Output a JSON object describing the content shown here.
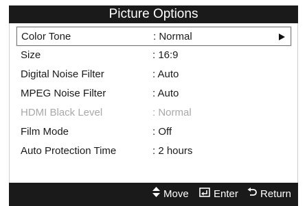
{
  "header": {
    "title": "Picture Options"
  },
  "menu": {
    "items": [
      {
        "label": "Color Tone",
        "value": ": Normal"
      },
      {
        "label": "Size",
        "value": ": 16:9"
      },
      {
        "label": "Digital Noise Filter",
        "value": ": Auto"
      },
      {
        "label": "MPEG Noise Filter",
        "value": ": Auto"
      },
      {
        "label": "HDMI Black Level",
        "value": ": Normal"
      },
      {
        "label": "Film Mode",
        "value": ": Off"
      },
      {
        "label": "Auto Protection Time",
        "value": ": 2 hours"
      }
    ],
    "selected_index": 0,
    "disabled_index": 4
  },
  "footer": {
    "move_label": "Move",
    "enter_label": "Enter",
    "return_label": "Return",
    "icons": [
      "up-down-arrow-icon",
      "enter-icon",
      "return-icon"
    ]
  },
  "colors": {
    "bar": "#1a1a1a",
    "text": "#1a1a1a",
    "disabled_text": "#a8a8a8",
    "selection_border": "#7a7a7a"
  }
}
